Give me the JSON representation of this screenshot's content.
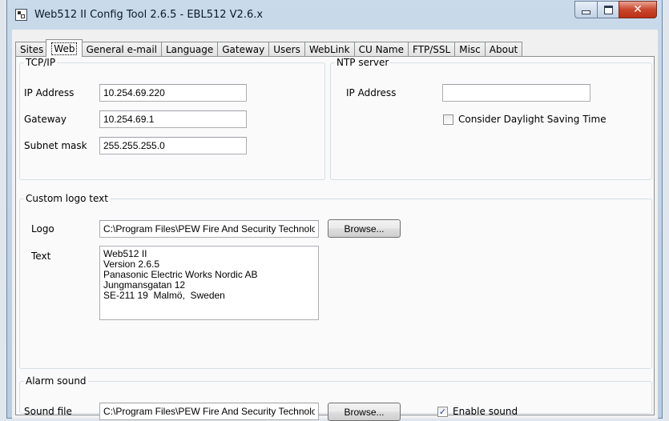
{
  "window": {
    "title": "Web512 II Config Tool 2.6.5 - EBL512 V2.6.x"
  },
  "tabs": [
    {
      "label": "Sites",
      "active": false
    },
    {
      "label": "Web",
      "active": true
    },
    {
      "label": "General e-mail",
      "active": false
    },
    {
      "label": "Language",
      "active": false
    },
    {
      "label": "Gateway",
      "active": false
    },
    {
      "label": "Users",
      "active": false
    },
    {
      "label": "WebLink",
      "active": false
    },
    {
      "label": "CU Name",
      "active": false
    },
    {
      "label": "FTP/SSL",
      "active": false
    },
    {
      "label": "Misc",
      "active": false
    },
    {
      "label": "About",
      "active": false
    }
  ],
  "tcpip": {
    "legend": "TCP/IP",
    "ip_label": "IP Address",
    "ip_value": "10.254.69.220",
    "gateway_label": "Gateway",
    "gateway_value": "10.254.69.1",
    "subnet_label": "Subnet mask",
    "subnet_value": "255.255.255.0"
  },
  "ntp": {
    "legend": "NTP server",
    "ip_label": "IP Address",
    "ip_value": "",
    "dst_label": "Consider Daylight Saving Time",
    "dst_checked": false
  },
  "logo_text": {
    "legend": "Custom logo  text",
    "logo_label": "Logo",
    "logo_value": "C:\\Program Files\\PEW Fire And Security Technologies",
    "browse_label": "Browse...",
    "text_label": "Text",
    "text_value": "Web512 II\nVersion 2.6.5\nPanasonic Electric Works Nordic AB\nJungmansgatan 12\nSE-211 19  Malmö,  Sweden"
  },
  "alarm": {
    "legend": "Alarm sound",
    "sound_label": "Sound file",
    "sound_value": "C:\\Program Files\\PEW Fire And Security Technologies",
    "browse_label": "Browse...",
    "enable_label": "Enable sound",
    "enable_checked": true
  },
  "icons": {
    "app": "app-icon",
    "minimize": "minimize-icon",
    "maximize": "maximize-icon",
    "close": "close-icon",
    "check": "checkmark-icon"
  },
  "colors": {
    "close_button": "#c9462c",
    "titlebar": "#c9daea",
    "panel": "#fafafa"
  }
}
